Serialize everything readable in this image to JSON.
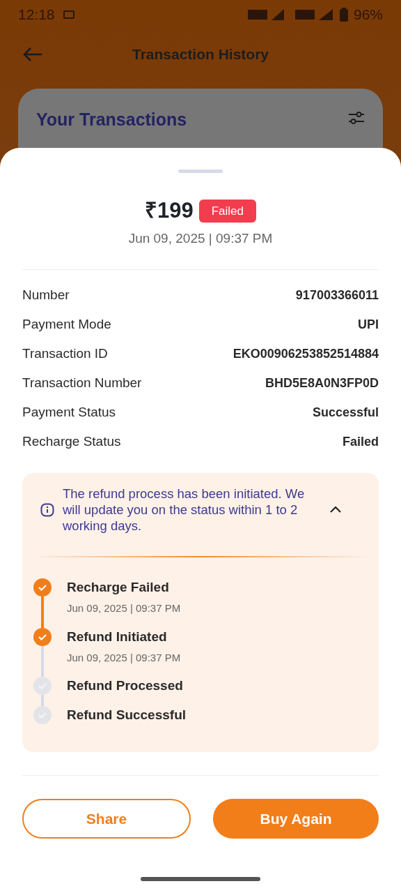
{
  "status_bar": {
    "time": "12:18",
    "battery": "96%"
  },
  "header": {
    "title": "Transaction History"
  },
  "background_card": {
    "title": "Your Transactions"
  },
  "sheet": {
    "amount": "₹199",
    "badge": "Failed",
    "datetime": "Jun 09, 2025 | 09:37 PM",
    "details": [
      {
        "label": "Number",
        "value": "917003366011"
      },
      {
        "label": "Payment Mode",
        "value": "UPI"
      },
      {
        "label": "Transaction ID",
        "value": "EKO00906253852514884"
      },
      {
        "label": "Transaction Number",
        "value": "BHD5E8A0N3FP0D"
      },
      {
        "label": "Payment Status",
        "value": "Successful"
      },
      {
        "label": "Recharge Status",
        "value": "Failed"
      }
    ],
    "refund": {
      "message": "The refund process has been initiated. We will update you on the status within 1 to 2 working days.",
      "expanded": true,
      "steps": [
        {
          "title": "Recharge Failed",
          "date": "Jun 09, 2025 | 09:37 PM",
          "completed": true
        },
        {
          "title": "Refund Initiated",
          "date": "Jun 09, 2025 | 09:37 PM",
          "completed": true
        },
        {
          "title": "Refund Processed",
          "completed": false
        },
        {
          "title": "Refund Successful",
          "completed": false
        }
      ]
    },
    "buttons": [
      {
        "label": "Share",
        "kind": "outline"
      },
      {
        "label": "Buy Again",
        "kind": "filled"
      }
    ]
  }
}
